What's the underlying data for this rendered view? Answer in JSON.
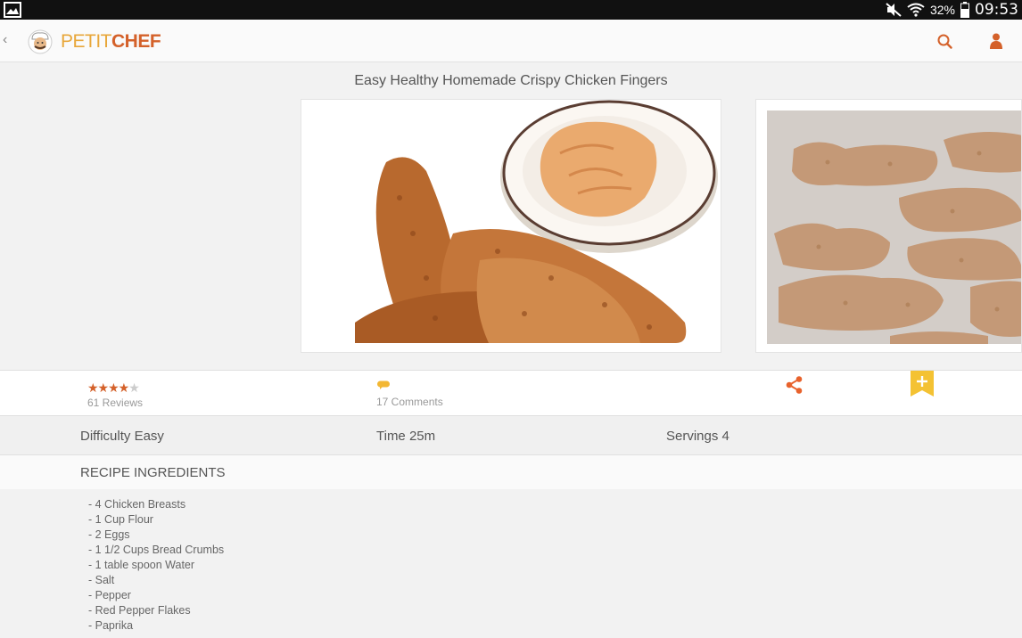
{
  "status_bar": {
    "battery_percent": "32%",
    "time": "09:53",
    "icons": [
      "gallery-icon",
      "mute-icon",
      "wifi-icon",
      "battery-icon"
    ]
  },
  "app_bar": {
    "logo_petit": "PETIT",
    "logo_chef": "CHEF",
    "icons": [
      "back-icon",
      "chef-logo-icon",
      "search-icon",
      "user-icon"
    ],
    "colors": {
      "logo_orange": "#e8a73a",
      "logo_red": "#d4612a"
    }
  },
  "recipe": {
    "title": "Easy Healthy Homemade Crispy Chicken Fingers",
    "rating": 4,
    "rating_max": 5,
    "reviews": "61 Reviews",
    "comments": "17 Comments",
    "difficulty": "Difficulty Easy",
    "time": "Time 25m",
    "servings": "Servings 4"
  },
  "ingredients": {
    "header": "RECIPE INGREDIENTS",
    "items": [
      "- 4 Chicken Breasts",
      "- 1 Cup Flour",
      "- 2 Eggs",
      "- 1 1/2 Cups Bread Crumbs",
      "- 1 table spoon Water",
      "- Salt",
      "- Pepper",
      "- Red Pepper Flakes",
      "- Paprika"
    ]
  },
  "accent_colors": {
    "star": "#d4612a",
    "comment": "#f3b733",
    "share": "#e8622c",
    "add": "#f4c233"
  }
}
